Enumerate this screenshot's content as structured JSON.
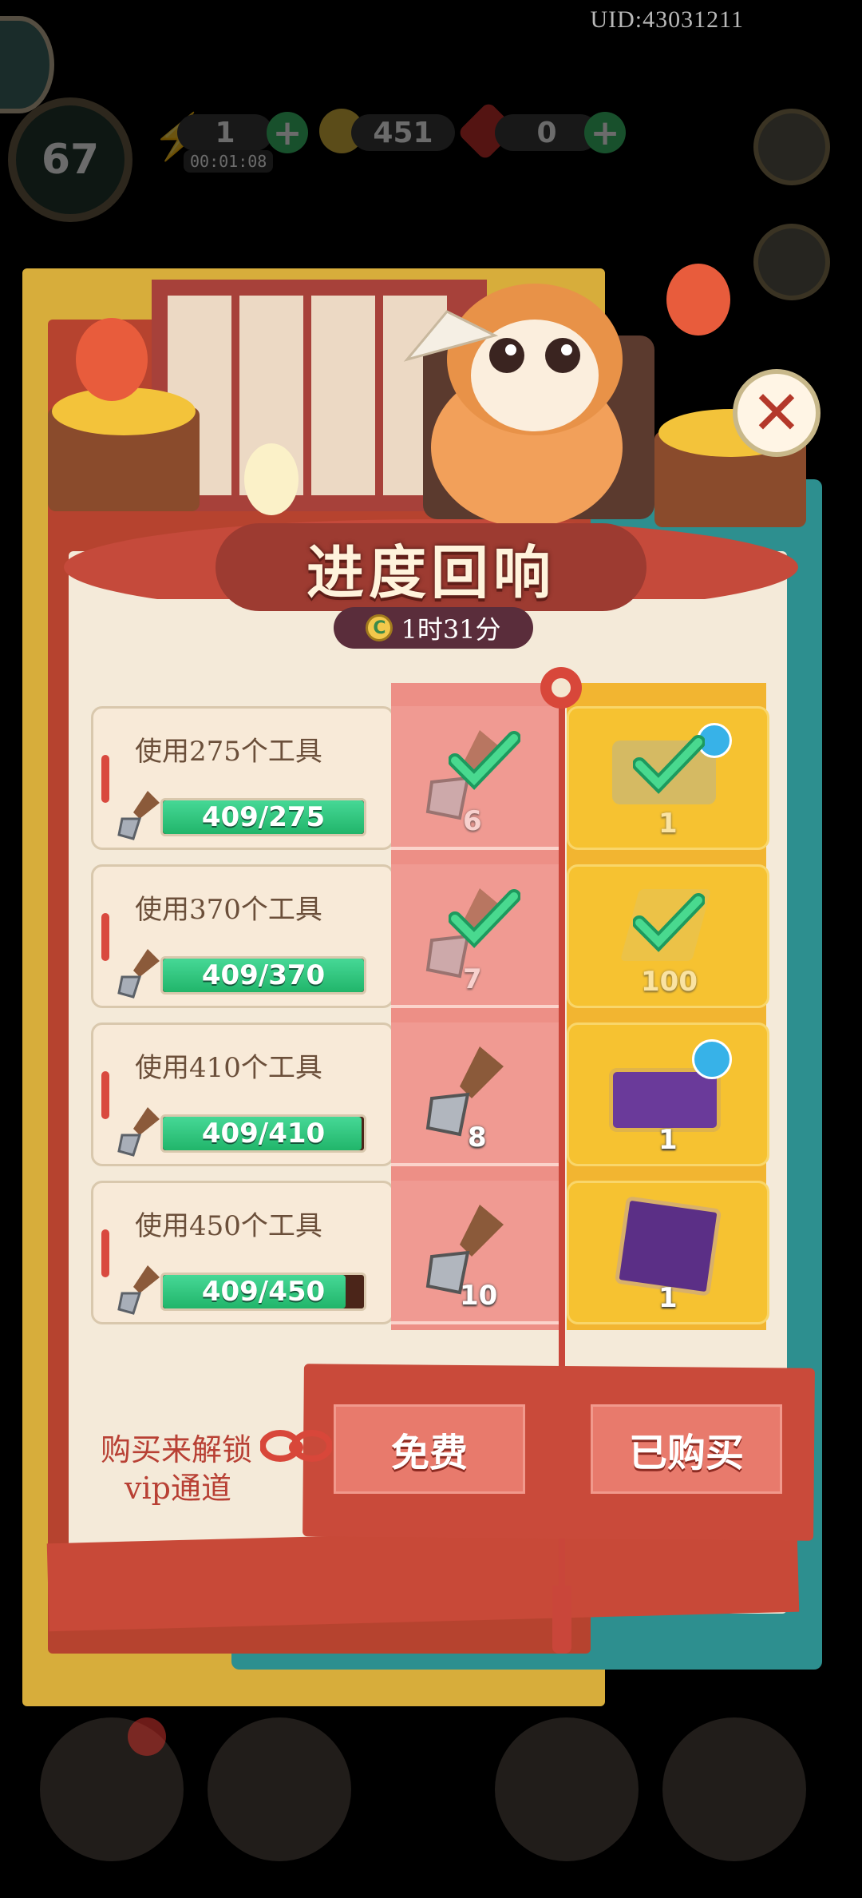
{
  "hud": {
    "uid": "UID:43031211",
    "level": "67",
    "energy": "1",
    "energy_timer": "00:01:08",
    "coins": "451",
    "gems": "0"
  },
  "panel": {
    "title": "进度回响",
    "timer": "1时31分",
    "rows": [
      {
        "task": "使用275个工具",
        "progress": "409/275",
        "progress_fraction": 1.0,
        "free_count": "6",
        "vip_count": "1",
        "free_claimed": true,
        "vip_claimed": true,
        "vip_reward": "gold-chest-icon"
      },
      {
        "task": "使用370个工具",
        "progress": "409/370",
        "progress_fraction": 1.0,
        "free_count": "7",
        "vip_count": "100",
        "free_claimed": true,
        "vip_claimed": true,
        "vip_reward": "gold-bar-icon"
      },
      {
        "task": "使用410个工具",
        "progress": "409/410",
        "progress_fraction": 0.998,
        "free_count": "8",
        "vip_count": "1",
        "free_claimed": false,
        "vip_claimed": false,
        "vip_reward": "purple-chest-icon"
      },
      {
        "task": "使用450个工具",
        "progress": "409/450",
        "progress_fraction": 0.909,
        "free_count": "10",
        "vip_count": "1",
        "free_claimed": false,
        "vip_claimed": false,
        "vip_reward": "card-bundle-icon"
      }
    ],
    "vip_note_line1": "购买来解锁",
    "vip_note_line2": "vip通道",
    "free_button": "免费",
    "bought_button": "已购买"
  }
}
